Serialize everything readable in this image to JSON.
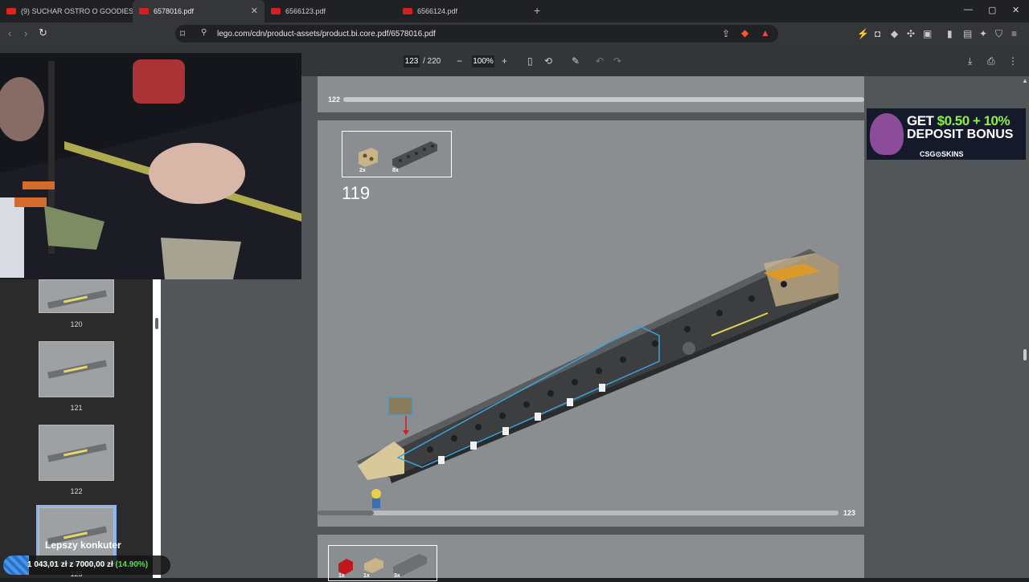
{
  "tabs": [
    {
      "title": "(9) SUCHAR OSTRO O GOODIES! OD",
      "favicon_color": "#e62117"
    },
    {
      "title": "6578016.pdf",
      "favicon_color": "#d42020"
    },
    {
      "title": "6566123.pdf",
      "favicon_color": "#d42020"
    },
    {
      "title": "6566124.pdf",
      "favicon_color": "#d42020"
    }
  ],
  "new_tab_label": "+",
  "window": {
    "minimize": "—",
    "maximize": "▢",
    "close": "✕"
  },
  "address": {
    "url": "lego.com/cdn/product-assets/product.bi.core.pdf/6578016.pdf"
  },
  "pdf_toolbar": {
    "current_page": "123",
    "total_pages": "/ 220",
    "zoom": "100%"
  },
  "thumbnails": [
    {
      "label": "120"
    },
    {
      "label": "121"
    },
    {
      "label": "122"
    },
    {
      "label": "123"
    }
  ],
  "pages": {
    "prev_page_number": "122",
    "current_page_number": "123",
    "step_number": "119",
    "parts": [
      {
        "qty": "2x",
        "color": "#c9b48a"
      },
      {
        "qty": "8x",
        "color": "#4a4c4e"
      }
    ],
    "next_parts": [
      {
        "qty": "1x",
        "color": "#c0171f"
      },
      {
        "qty": "1x",
        "color": "#c9b48a"
      },
      {
        "qty": "3x",
        "color": "#6d6f71"
      }
    ]
  },
  "ad": {
    "line1_prefix": "GET ",
    "line1_highlight": "$0.50 + 10%",
    "line2": "DEPOSIT BONUS",
    "brand": "CSG⊙SKINS"
  },
  "overlay": {
    "goal_title": "Lepszy konkuter",
    "goal_amount": "1 043,01 zł",
    "goal_of": " z ",
    "goal_target": "7000,00 zł",
    "goal_percent": " (14.90%)"
  }
}
